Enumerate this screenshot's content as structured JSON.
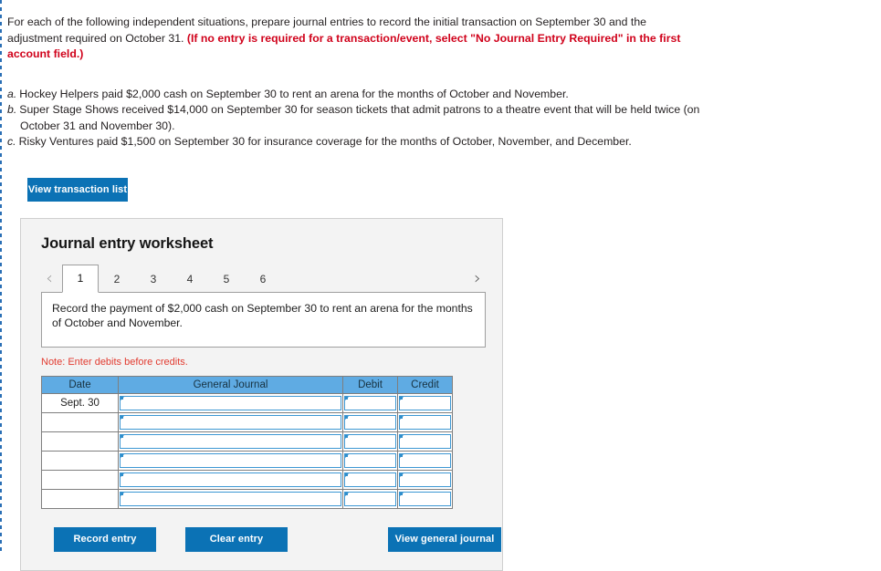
{
  "prompt": {
    "line1": "For each of the following independent situations, prepare journal entries to record the initial transaction on September 30 and the",
    "line2": "adjustment required on October 31.",
    "bold_red": "(If no entry is required for a transaction/event, select \"No Journal Entry Required\" in the first account field.)"
  },
  "situations": [
    {
      "letter": "a.",
      "text": "Hockey Helpers paid $2,000 cash on September 30 to rent an arena for the months of October and November."
    },
    {
      "letter": "b.",
      "text": "Super Stage Shows received $14,000 on September 30 for season tickets that admit patrons to a theatre event that will be held twice (on October 31 and November 30)."
    },
    {
      "letter": "c.",
      "text": "Risky Ventures paid $1,500 on September 30 for insurance coverage for the months of October, November, and December."
    }
  ],
  "toolbar": {
    "view_transaction_list_label": "View transaction list"
  },
  "worksheet": {
    "title": "Journal entry worksheet",
    "prev_arrow": "‹",
    "next_arrow": "›",
    "tabs": [
      {
        "label": "1",
        "active": true
      },
      {
        "label": "2",
        "active": false
      },
      {
        "label": "3",
        "active": false
      },
      {
        "label": "4",
        "active": false
      },
      {
        "label": "5",
        "active": false
      },
      {
        "label": "6",
        "active": false
      }
    ],
    "instruction": "Record the payment of $2,000 cash on September 30 to rent an arena for the months of October and November.",
    "note": "Note: Enter debits before credits.",
    "table": {
      "headers": [
        "Date",
        "General Journal",
        "Debit",
        "Credit"
      ],
      "rows": [
        {
          "date": "Sept. 30",
          "general_journal": "",
          "debit": "",
          "credit": ""
        },
        {
          "date": "",
          "general_journal": "",
          "debit": "",
          "credit": ""
        },
        {
          "date": "",
          "general_journal": "",
          "debit": "",
          "credit": ""
        },
        {
          "date": "",
          "general_journal": "",
          "debit": "",
          "credit": ""
        },
        {
          "date": "",
          "general_journal": "",
          "debit": "",
          "credit": ""
        },
        {
          "date": "",
          "general_journal": "",
          "debit": "",
          "credit": ""
        }
      ]
    },
    "buttons": {
      "record_entry": "Record entry",
      "clear_entry": "Clear entry",
      "view_general_journal": "View general journal"
    }
  },
  "colors": {
    "button_blue": "#0b72b5",
    "table_header_blue": "#5fabe3",
    "note_red": "#e23b30",
    "panel_bg": "#f3f3f3",
    "field_border_blue": "#3c97d3"
  }
}
